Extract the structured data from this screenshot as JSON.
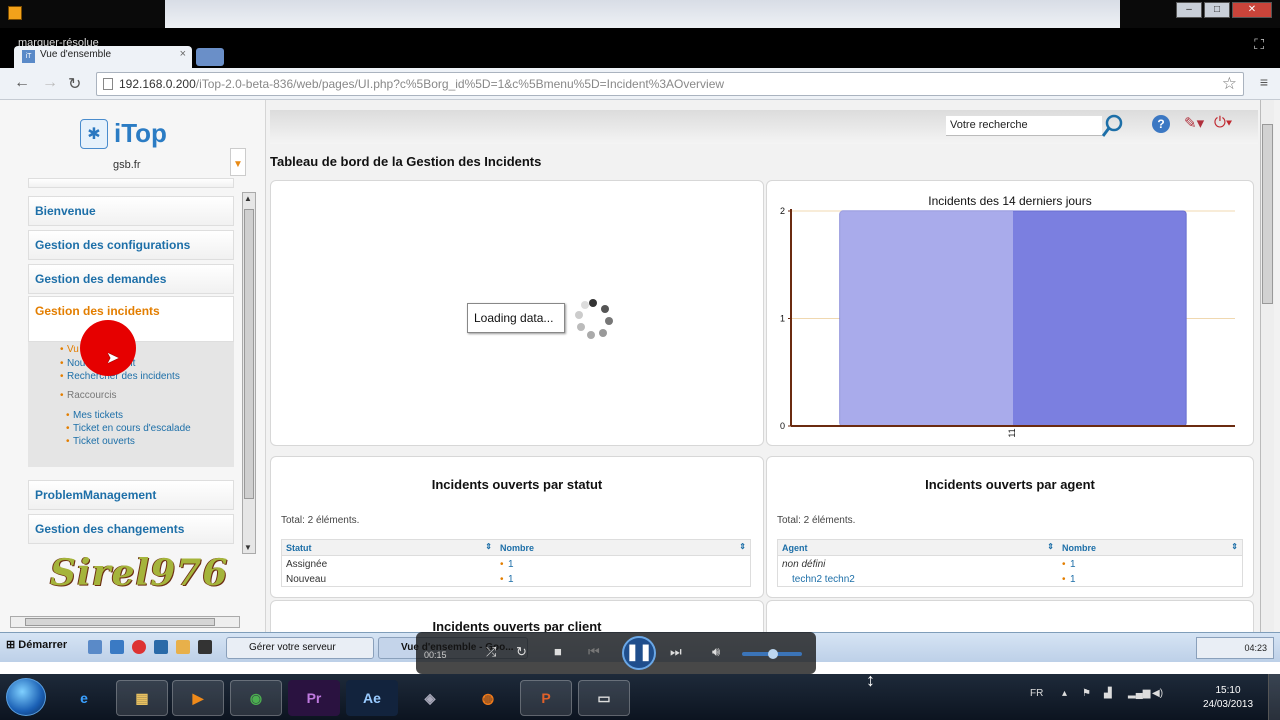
{
  "browser": {
    "overlay_title": "marquer-résolue",
    "tab_title": "Vue d'ensemble",
    "tab_close": "×",
    "url_host": "192.168.0.200",
    "url_path": "/iTop-2.0-beta-836/web/pages/UI.php?c%5Borg_id%5D=1&c%5Bmenu%5D=Incident%3AOverview"
  },
  "app": {
    "logo_text": "iTop",
    "org": "gsb.fr",
    "search_placeholder": "Votre recherche",
    "page_title": "Tableau de bord de la Gestion des Incidents"
  },
  "menu": {
    "items": [
      {
        "label": "Bienvenue"
      },
      {
        "label": "Gestion des configurations"
      },
      {
        "label": "Gestion des demandes"
      },
      {
        "label": "Gestion des incidents"
      },
      {
        "label": "ProblemManagement"
      },
      {
        "label": "Gestion des changements"
      }
    ],
    "sub": {
      "vue": "Vu",
      "nouvel": "Nouvel incident",
      "rechercher": "Rechercher des incidents",
      "raccourcis": "Raccourcis",
      "mes_tickets": "Mes tickets",
      "escalade": "Ticket en cours d'escalade",
      "ouverts": "Ticket ouverts"
    }
  },
  "watermark": "Sirel976",
  "dashboard": {
    "loading_text": "Loading data...",
    "status_title": "Incidents ouverts par statut",
    "agent_title": "Incidents ouverts par agent",
    "client_title": "Incidents ouverts par client",
    "status_total": "Total: 2 éléments.",
    "agent_total": "Total: 2 éléments.",
    "status_table": {
      "headers": [
        "Statut",
        "Nombre"
      ],
      "rows": [
        [
          "Assignée",
          "1"
        ],
        [
          "Nouveau",
          "1"
        ]
      ]
    },
    "agent_table": {
      "headers": [
        "Agent",
        "Nombre"
      ],
      "rows": [
        [
          "non défini",
          "1"
        ],
        [
          "techn2 techn2",
          "1"
        ]
      ]
    }
  },
  "chart_data": {
    "type": "bar",
    "title": "Incidents des 14 derniers jours",
    "categories": [
      "11"
    ],
    "values": [
      2
    ],
    "ylim": [
      0,
      2
    ],
    "yticks": [
      0,
      1,
      2
    ],
    "xlabel": "",
    "ylabel": "",
    "bar_color": "#7b7fe0",
    "grid": true
  },
  "taskbar": {
    "start_label": "Démarrer",
    "task1": "Gérer votre serveur",
    "task2": "Vue d'ensemble - Goo...",
    "tray_time": "04:23"
  },
  "player": {
    "time": "00:15"
  },
  "win7": {
    "lang": "FR",
    "time": "15:10",
    "date": "24/03/2013",
    "apps": [
      "Ie",
      "Explorer",
      "Player",
      "Chrome",
      "Pr",
      "Ae",
      "VM",
      "Firefox",
      "PowerPoint",
      "Folder"
    ]
  }
}
